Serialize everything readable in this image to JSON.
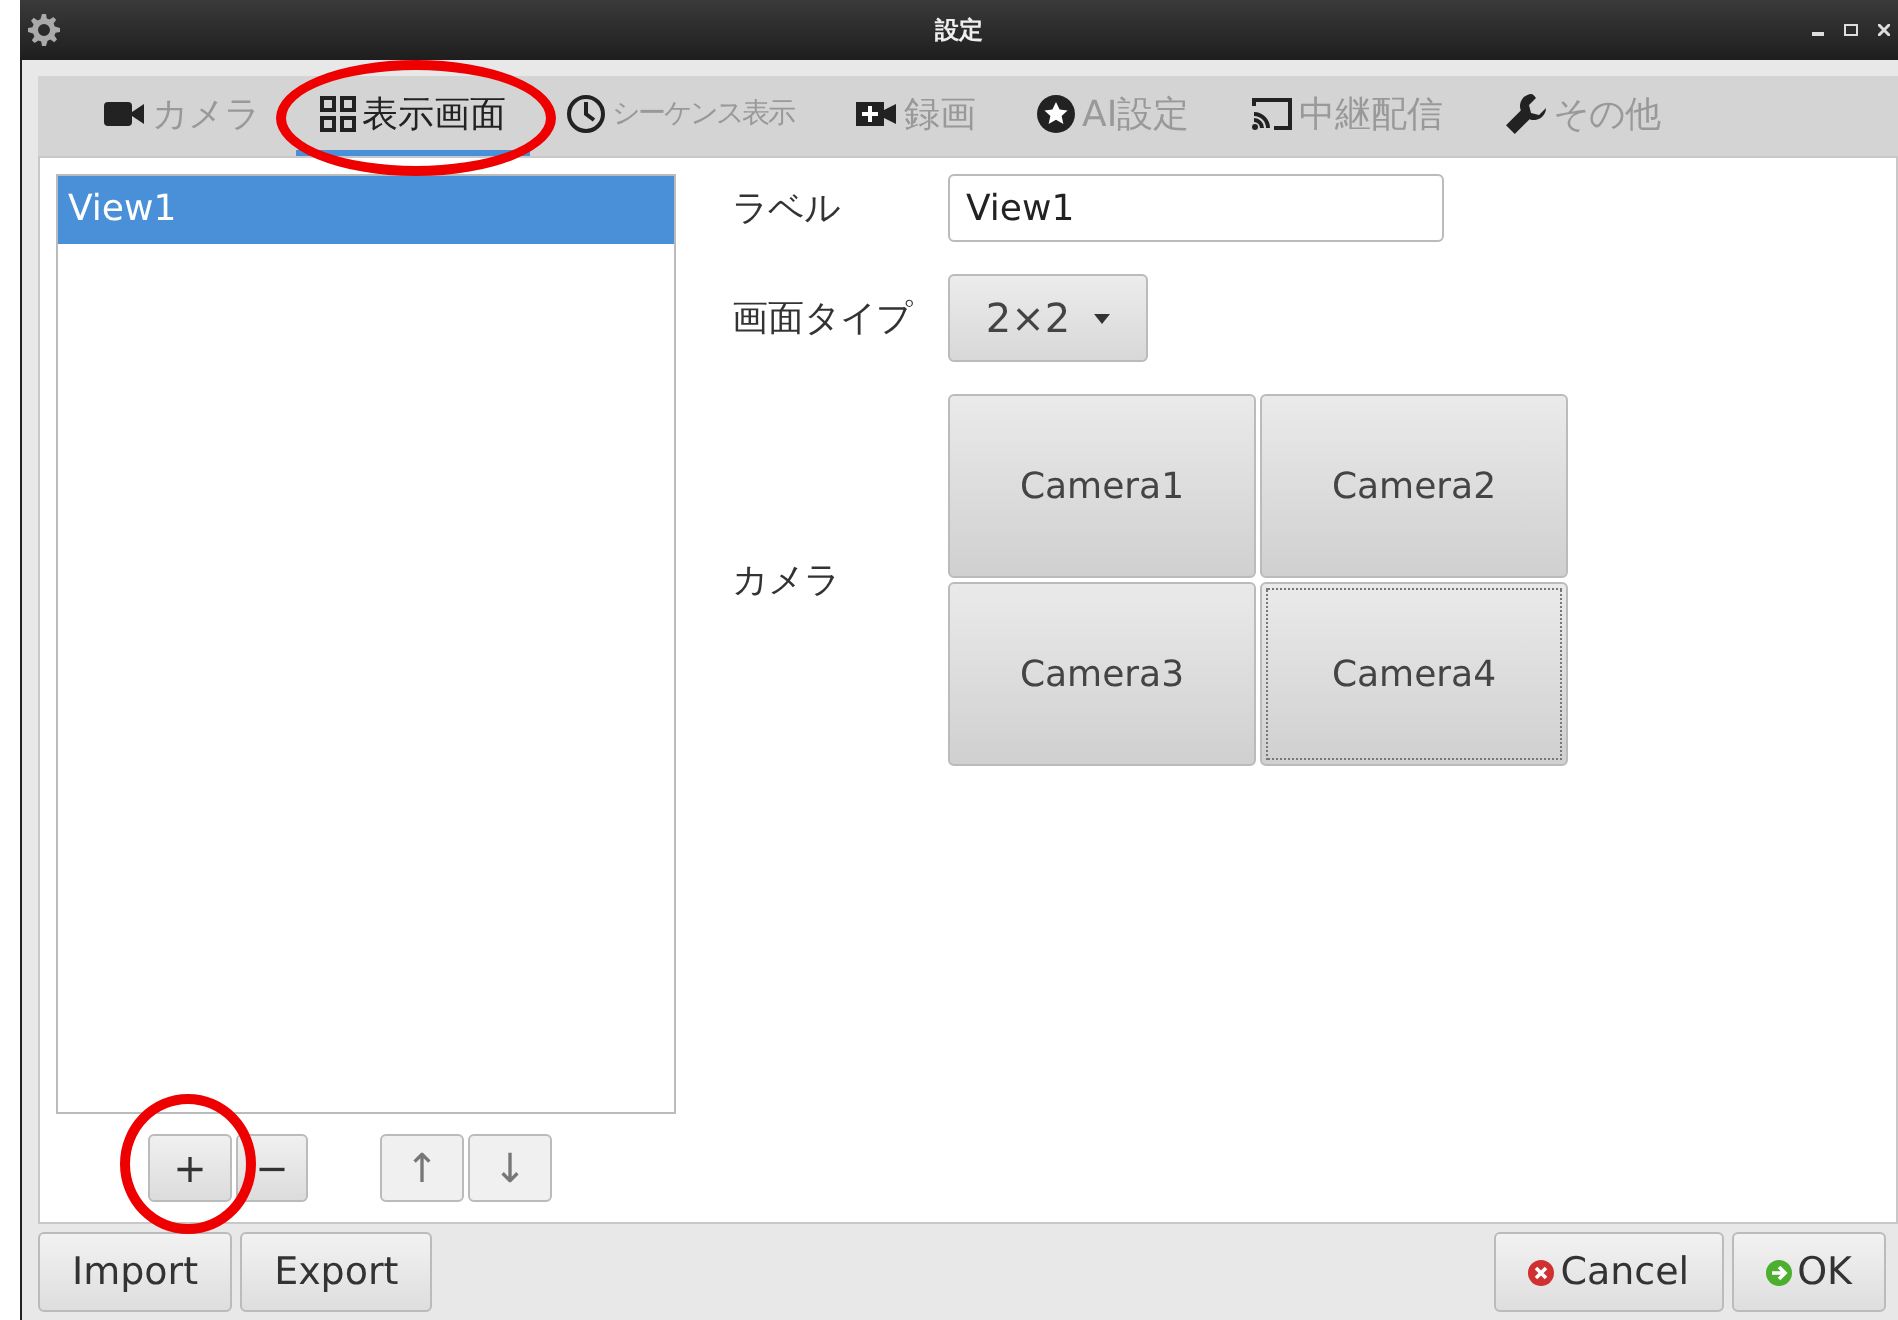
{
  "window": {
    "title": "設定"
  },
  "tabs": [
    {
      "label": "カメラ",
      "kind": "camera",
      "selected": false
    },
    {
      "label": "表示画面",
      "kind": "display",
      "selected": true
    },
    {
      "label": "シーケンス表示",
      "kind": "sequence",
      "selected": false
    },
    {
      "label": "録画",
      "kind": "record",
      "selected": false
    },
    {
      "label": "AI設定",
      "kind": "ai",
      "selected": false
    },
    {
      "label": "中継配信",
      "kind": "relay",
      "selected": false
    },
    {
      "label": "その他",
      "kind": "other",
      "selected": false
    }
  ],
  "view_list": {
    "items": [
      {
        "label": "View1",
        "selected": true
      }
    ]
  },
  "list_buttons": [
    {
      "label": "+",
      "kind": "add"
    },
    {
      "label": "−",
      "kind": "remove"
    },
    {
      "label": "↑",
      "kind": "up"
    },
    {
      "label": "↓",
      "kind": "down"
    }
  ],
  "form": {
    "label_field": {
      "label": "ラベル",
      "value": "View1"
    },
    "screen_type": {
      "label": "画面タイプ",
      "value": "2×2"
    },
    "cameras": {
      "label": "カメラ",
      "items": [
        {
          "label": "Camera1",
          "focused": false
        },
        {
          "label": "Camera2",
          "focused": false
        },
        {
          "label": "Camera3",
          "focused": false
        },
        {
          "label": "Camera4",
          "focused": true
        }
      ]
    }
  },
  "footer": {
    "left": [
      {
        "label": "Import"
      },
      {
        "label": "Export"
      }
    ],
    "right": [
      {
        "label": "Cancel",
        "kind": "cancel"
      },
      {
        "label": "OK",
        "kind": "ok"
      }
    ]
  },
  "annotations": [
    {
      "kind": "circle"
    },
    {
      "kind": "circle"
    }
  ]
}
